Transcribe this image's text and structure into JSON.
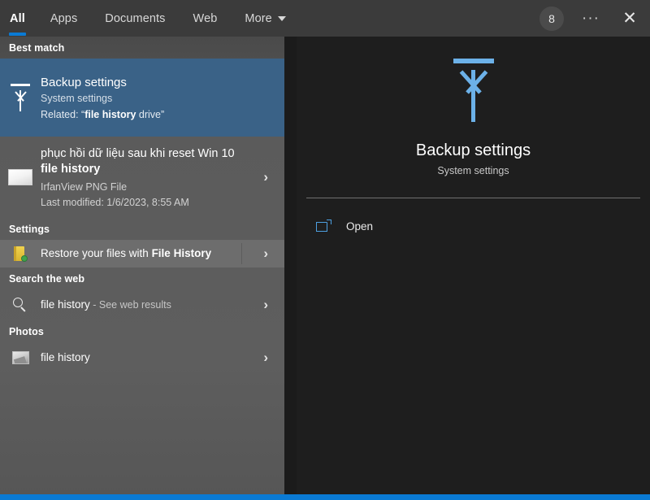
{
  "topbar": {
    "tabs": [
      {
        "label": "All",
        "active": true
      },
      {
        "label": "Apps",
        "active": false
      },
      {
        "label": "Documents",
        "active": false
      },
      {
        "label": "Web",
        "active": false
      },
      {
        "label": "More",
        "active": false,
        "has_caret": true
      }
    ],
    "avatar_initial": "8",
    "more_options_glyph": "···",
    "close_glyph": "✕"
  },
  "results": {
    "best_match": {
      "header": "Best match",
      "icon": "backup-upload-arrow-icon",
      "title": "Backup settings",
      "subtitle": "System settings",
      "related_prefix": "Related: “",
      "related_bold": "file history",
      "related_suffix": " drive”",
      "chevron": "›"
    },
    "file_result": {
      "icon": "png-thumbnail-icon",
      "title_normal": "phục hồi dữ liệu sau khi reset Win 10 ",
      "title_bold": "file history",
      "type": "IrfanView PNG File",
      "modified": "Last modified: 1/6/2023, 8:55 AM",
      "chevron": "›"
    },
    "settings": {
      "header": "Settings",
      "icon": "file-history-folder-icon",
      "label_normal": "Restore your files with ",
      "label_bold": "File History",
      "chevron": "›"
    },
    "web": {
      "header": "Search the web",
      "icon": "search-icon",
      "query": "file history",
      "suffix": " - See web results",
      "chevron": "›"
    },
    "photos": {
      "header": "Photos",
      "icon": "photo-thumbnail-icon",
      "label": "file history",
      "chevron": "›"
    }
  },
  "preview": {
    "icon": "backup-upload-arrow-icon",
    "title": "Backup settings",
    "subtitle": "System settings",
    "actions": [
      {
        "icon": "open-external-icon",
        "label": "Open"
      }
    ]
  },
  "colors": {
    "accent_blue": "#0a7ad4",
    "selection_blue": "#3a6287",
    "icon_blue": "#6cb1e8",
    "panel_gray": "#5b5b5b",
    "preview_dark": "#1e1e1e",
    "topbar_gray": "#3b3b3b"
  }
}
